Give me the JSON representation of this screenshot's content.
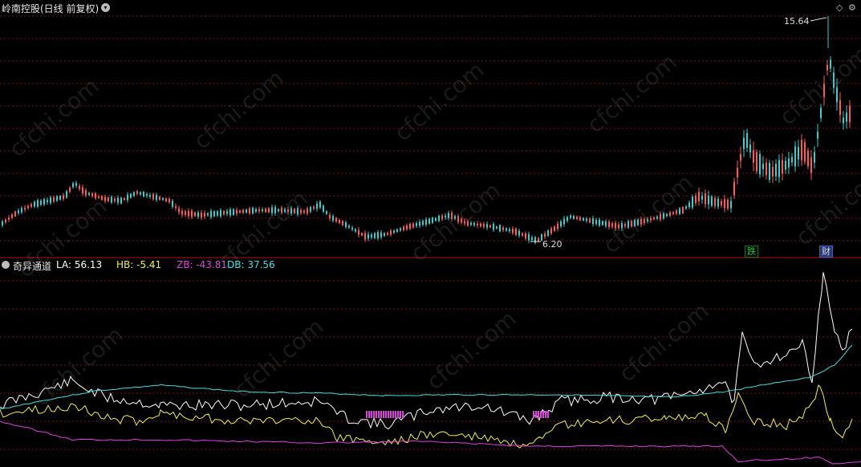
{
  "header": {
    "title": "岭南控股(日线 前复权)",
    "menu_icon": "chevron-down-icon",
    "corner_icons": [
      "diamond-icon",
      "gear-icon"
    ]
  },
  "price_panel": {
    "high_label": "15.64",
    "low_label": "6.20",
    "event_tags": [
      {
        "text": "跌",
        "color": "#25c04a"
      },
      {
        "text": "财",
        "color": "#d8d8d8"
      }
    ]
  },
  "indicator": {
    "name": "奇异通道",
    "values": [
      {
        "label": "LA: 56.13",
        "color": "#ffffff"
      },
      {
        "label": "HB: -5.41",
        "color": "#f2f23a"
      },
      {
        "label": "ZB: -43.81",
        "color": "#e040e0"
      },
      {
        "label": "DB: 37.56",
        "color": "#3ce0e0"
      }
    ]
  },
  "watermark": "cfchi.com",
  "colors": {
    "up": "#ff5a5a",
    "down": "#35d0d0",
    "grid": "#7a1212",
    "divider": "#b01010"
  }
}
